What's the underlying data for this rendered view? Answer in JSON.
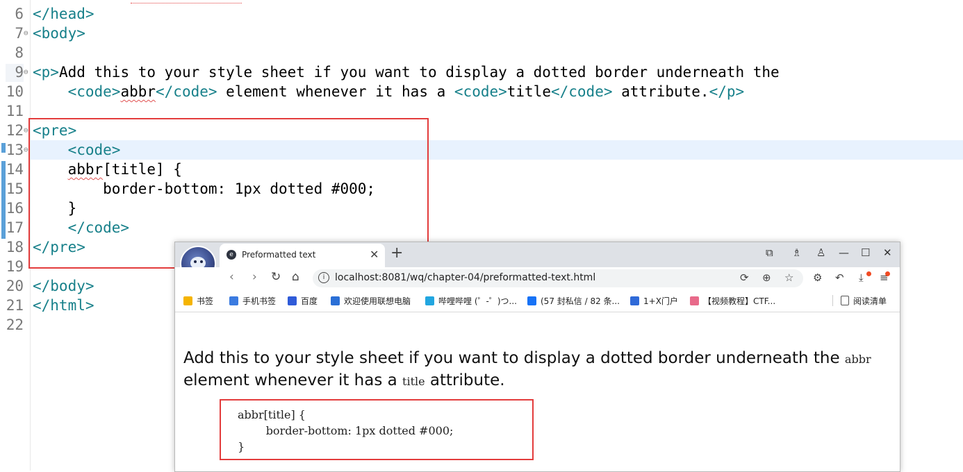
{
  "editor": {
    "lines": [
      {
        "num": "6",
        "fold": "",
        "parts": [
          {
            "t": "</head>",
            "c": "tag"
          }
        ]
      },
      {
        "num": "7",
        "fold": "⊖",
        "parts": [
          {
            "t": "<body>",
            "c": "tag"
          }
        ]
      },
      {
        "num": "8",
        "fold": "",
        "parts": []
      },
      {
        "num": "9",
        "fold": "⊖",
        "parts": [
          {
            "t": "<p>",
            "c": "tag"
          },
          {
            "t": "Add this to your style sheet if you want to display a dotted border underneath the",
            "c": ""
          }
        ]
      },
      {
        "num": "10",
        "fold": "",
        "parts": [
          {
            "t": "    ",
            "c": ""
          },
          {
            "t": "<code>",
            "c": "tag"
          },
          {
            "t": "abbr",
            "c": "squig"
          },
          {
            "t": "</code>",
            "c": "tag"
          },
          {
            "t": " element whenever it has a ",
            "c": ""
          },
          {
            "t": "<code>",
            "c": "tag"
          },
          {
            "t": "title",
            "c": ""
          },
          {
            "t": "</code>",
            "c": "tag"
          },
          {
            "t": " attribute.",
            "c": ""
          },
          {
            "t": "</p>",
            "c": "tag"
          }
        ]
      },
      {
        "num": "11",
        "fold": "",
        "parts": []
      },
      {
        "num": "12",
        "fold": "⊖",
        "parts": [
          {
            "t": "<pre>",
            "c": "tag"
          }
        ]
      },
      {
        "num": "13",
        "fold": "⊖",
        "current": true,
        "parts": [
          {
            "t": "    ",
            "c": ""
          },
          {
            "t": "<code>",
            "c": "tag"
          }
        ]
      },
      {
        "num": "14",
        "fold": "",
        "parts": [
          {
            "t": "    ",
            "c": ""
          },
          {
            "t": "abbr",
            "c": "squig"
          },
          {
            "t": "[title] {",
            "c": ""
          }
        ]
      },
      {
        "num": "15",
        "fold": "",
        "parts": [
          {
            "t": "        border-bottom: 1px dotted #000;",
            "c": ""
          }
        ]
      },
      {
        "num": "16",
        "fold": "",
        "parts": [
          {
            "t": "    }",
            "c": ""
          }
        ]
      },
      {
        "num": "17",
        "fold": "",
        "parts": [
          {
            "t": "    ",
            "c": ""
          },
          {
            "t": "</code>",
            "c": "tag"
          }
        ]
      },
      {
        "num": "18",
        "fold": "",
        "parts": [
          {
            "t": "</pre>",
            "c": "tag"
          }
        ]
      },
      {
        "num": "19",
        "fold": "",
        "parts": []
      },
      {
        "num": "20",
        "fold": "",
        "parts": [
          {
            "t": "</body>",
            "c": "tag"
          }
        ]
      },
      {
        "num": "21",
        "fold": "",
        "parts": [
          {
            "t": "</html>",
            "c": "tag"
          }
        ]
      },
      {
        "num": "22",
        "fold": "",
        "parts": []
      }
    ]
  },
  "browser": {
    "tab_title": "Preformatted text",
    "url": "localhost:8081/wq/chapter-04/preformatted-text.html",
    "bookmarks": [
      {
        "label": "书签",
        "color": "#f5b400",
        "icon": "star-icon"
      },
      {
        "label": "手机书签",
        "color": "#3b7be0",
        "icon": "phone-icon"
      },
      {
        "label": "百度",
        "color": "#2f5bd8",
        "icon": "baidu-icon"
      },
      {
        "label": "欢迎使用联想电脑",
        "color": "#2a6fd6",
        "icon": "lenovo-icon"
      },
      {
        "label": "哔哩哔哩 (゜-゜)つ...",
        "color": "#22a6e0",
        "icon": "bilibili-icon"
      },
      {
        "label": "(57 封私信 / 82 条...",
        "color": "#1772f6",
        "icon": "zhihu-icon"
      },
      {
        "label": "1+X门户",
        "color": "#2f6ad8",
        "icon": "portal-icon"
      },
      {
        "label": "【视频教程】CTF...",
        "color": "#e86a8a",
        "icon": "video-icon"
      }
    ],
    "reading_list": "阅读清单",
    "content": {
      "para_before": "Add this to your style sheet if you want to display a dotted border underneath the ",
      "code1": "abbr",
      "para_mid": " element whenever it has a ",
      "code2": "title",
      "para_after": " attribute.",
      "pre_text": "abbr[title] {\n        border-bottom: 1px dotted #000;\n}"
    }
  },
  "colors": {
    "tag": "#17808a",
    "highlight_box": "#e33c3c",
    "current_line": "#e8f2fe"
  }
}
